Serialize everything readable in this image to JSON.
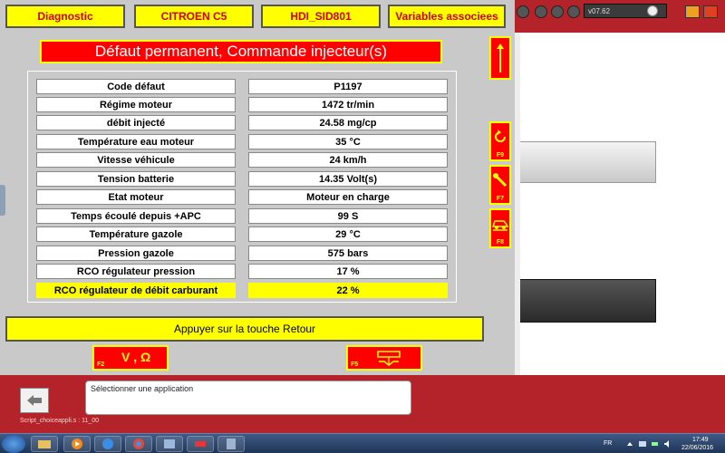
{
  "header": {
    "tabs": [
      "Diagnostic",
      "CITROEN C5",
      "HDI_SID801",
      "Variables associees"
    ]
  },
  "title": "Défaut permanent, Commande injecteur(s)",
  "table": {
    "rows": [
      {
        "label": "Code défaut",
        "value": "P1197"
      },
      {
        "label": "Régime moteur",
        "value": "1472    tr/min"
      },
      {
        "label": "débit injecté",
        "value": "24.58    mg/cp"
      },
      {
        "label": "Température eau moteur",
        "value": "35    °C"
      },
      {
        "label": "Vitesse véhicule",
        "value": "24    km/h"
      },
      {
        "label": "Tension batterie",
        "value": "14.35    Volt(s)"
      },
      {
        "label": "Etat moteur",
        "value": "Moteur en charge"
      },
      {
        "label": "Temps écoulé depuis +APC",
        "value": "99    S"
      },
      {
        "label": "Température gazole",
        "value": "29    °C"
      },
      {
        "label": "Pression gazole",
        "value": "575    bars"
      },
      {
        "label": "RCO régulateur pression",
        "value": "17    %"
      },
      {
        "label": "RCO régulateur de débit carburant",
        "value": "22    %"
      }
    ],
    "highlighted_row": 11
  },
  "message": "Appuyer sur la touche Retour",
  "function_buttons": {
    "f2_key": "F2",
    "f2_text": "V , Ω",
    "f5_key": "F5"
  },
  "side_buttons": {
    "f9_key": "F9",
    "f7_key": "F7",
    "f8_key": "F8"
  },
  "background_app": {
    "version": "v07.62",
    "select_text": "Sélectionner une application",
    "script_label": "Script_choiceappli.s : 11_00"
  },
  "taskbar": {
    "lang": "FR",
    "time": "17:49",
    "date": "22/06/2016"
  },
  "colors": {
    "yellow": "#ffff00",
    "red": "#ff0000",
    "panel_grey": "#c9c9c9",
    "bg_red": "#b5232a"
  }
}
